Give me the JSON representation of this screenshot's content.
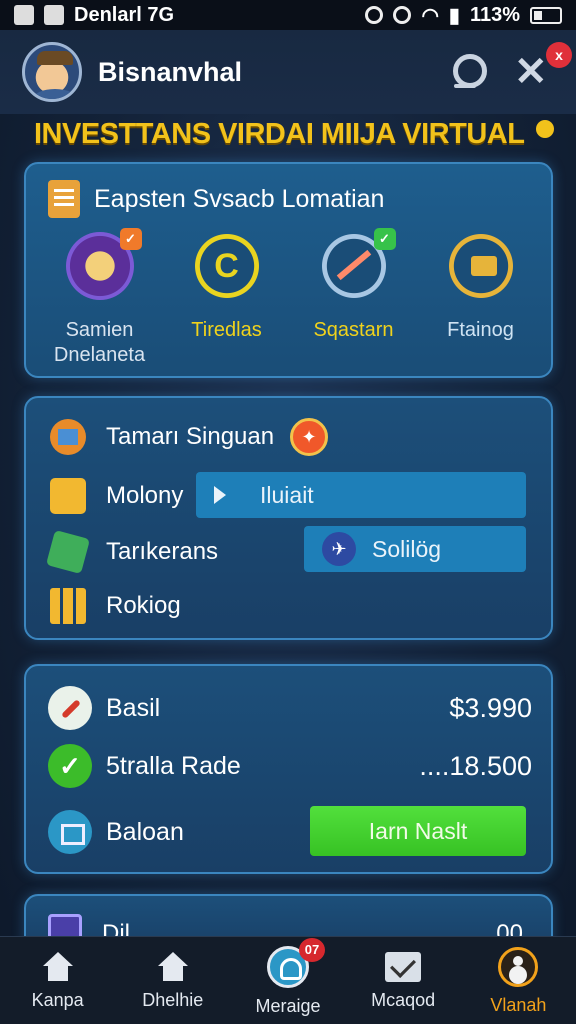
{
  "status_bar": {
    "app_name": "Denlarl 7G",
    "battery": "113%"
  },
  "header": {
    "username": "Bisnanvhal",
    "close_badge": "x"
  },
  "banner": {
    "title": "INVESTTANS VIRDAI MIIJA VIRTUAL"
  },
  "features_card": {
    "title": "Eapsten Svsacb Lomatian",
    "items": [
      {
        "label": "Samien Dnelaneta",
        "icon": "globe-icon",
        "badge": "✓"
      },
      {
        "label": "Tiredlas",
        "icon": "coin-icon"
      },
      {
        "label": "Sqastarn",
        "icon": "chart-up-icon",
        "badge": "✓"
      },
      {
        "label": "Ftainog",
        "icon": "gold-bars-icon"
      }
    ]
  },
  "options_card": {
    "title": "Tamarı Singuan",
    "rows": [
      {
        "label": "Molony",
        "icon": "folder-icon"
      },
      {
        "label": "Tarıkerans",
        "icon": "cube-icon"
      },
      {
        "label": "Rokiog",
        "icon": "grid-icon"
      }
    ],
    "pill_1": "Iluiait",
    "pill_2": "Solilög"
  },
  "balance_card": {
    "rows": [
      {
        "label": "Basil",
        "amount": "$3.990",
        "icon": "rocket-icon"
      },
      {
        "label": "5tralla Rade",
        "amount": "....18.500",
        "icon": "check-icon"
      },
      {
        "label": "Baloan",
        "icon": "box-icon"
      }
    ],
    "earn_button": "Iarn Naslt"
  },
  "partial_card": {
    "label": "Dil",
    "value": "00"
  },
  "tab_bar": {
    "tabs": [
      {
        "label": "Kanpa",
        "icon": "home-icon"
      },
      {
        "label": "Dhelhie",
        "icon": "home-icon"
      },
      {
        "label": "Meraige",
        "icon": "messages-icon",
        "badge": "07"
      },
      {
        "label": "Mcaqod",
        "icon": "mail-icon"
      },
      {
        "label": "Vlanah",
        "icon": "profile-icon",
        "active": true
      }
    ]
  },
  "colors": {
    "accent_yellow": "#f2c21b",
    "card_blue": "#1e5e8e",
    "earn_green": "#37c224",
    "active_tab": "#f2a21b"
  }
}
